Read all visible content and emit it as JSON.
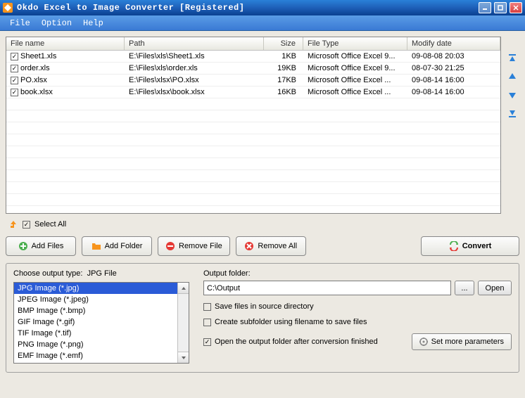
{
  "window": {
    "title": "Okdo Excel to Image Converter [Registered]"
  },
  "menu": {
    "file": "File",
    "option": "Option",
    "help": "Help"
  },
  "table": {
    "headers": {
      "name": "File name",
      "path": "Path",
      "size": "Size",
      "type": "File Type",
      "date": "Modify date"
    },
    "rows": [
      {
        "checked": true,
        "name": "Sheet1.xls",
        "path": "E:\\Files\\xls\\Sheet1.xls",
        "size": "1KB",
        "type": "Microsoft Office Excel 9...",
        "date": "09-08-08 20:03"
      },
      {
        "checked": true,
        "name": "order.xls",
        "path": "E:\\Files\\xls\\order.xls",
        "size": "19KB",
        "type": "Microsoft Office Excel 9...",
        "date": "08-07-30 21:25"
      },
      {
        "checked": true,
        "name": "PO.xlsx",
        "path": "E:\\Files\\xlsx\\PO.xlsx",
        "size": "17KB",
        "type": "Microsoft Office Excel ...",
        "date": "09-08-14 16:00"
      },
      {
        "checked": true,
        "name": "book.xlsx",
        "path": "E:\\Files\\xlsx\\book.xlsx",
        "size": "16KB",
        "type": "Microsoft Office Excel ...",
        "date": "09-08-14 16:00"
      }
    ]
  },
  "selectAll": {
    "checked": true,
    "label": "Select All"
  },
  "buttons": {
    "addFiles": "Add Files",
    "addFolder": "Add Folder",
    "removeFile": "Remove File",
    "removeAll": "Remove All",
    "convert": "Convert",
    "browse": "...",
    "open": "Open",
    "setMore": "Set more parameters"
  },
  "output": {
    "typeLabel": "Choose output type:",
    "currentType": "JPG File",
    "types": [
      "JPG Image (*.jpg)",
      "JPEG Image (*.jpeg)",
      "BMP Image (*.bmp)",
      "GIF Image (*.gif)",
      "TIF Image (*.tif)",
      "PNG Image (*.png)",
      "EMF Image (*.emf)"
    ],
    "selectedTypeIndex": 0,
    "folderLabel": "Output folder:",
    "folderValue": "C:\\Output",
    "opt1": {
      "checked": false,
      "label": "Save files in source directory"
    },
    "opt2": {
      "checked": false,
      "label": "Create subfolder using filename to save files"
    },
    "opt3": {
      "checked": true,
      "label": "Open the output folder after conversion finished"
    }
  },
  "colors": {
    "accentBlue": "#2a80d8",
    "green": "#4caf50",
    "orange": "#f7941d",
    "red": "#e53935"
  }
}
